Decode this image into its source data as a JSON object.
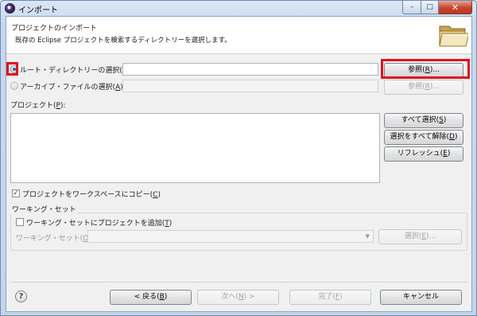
{
  "window": {
    "title": "インポート",
    "icon": "eclipse-icon",
    "controls": {
      "minimize": "–",
      "maximize": "□",
      "close": "✕"
    }
  },
  "header": {
    "title": "プロジェクトのインポート",
    "description": "既存の Eclipse プロジェクトを検索するディレクトリーを選択します。",
    "icon": "folder-icon"
  },
  "source": {
    "root_dir_label": "ルート・ディレクトリーの選択(",
    "root_dir_mnemonic": "T",
    "root_dir_selected": true,
    "root_dir_value": "",
    "root_browse_label": "参照(",
    "root_browse_mnemonic": "R",
    "archive_label": "アーカイブ・ファイルの選択(",
    "archive_mnemonic": "A",
    "archive_selected": false,
    "archive_value": "",
    "archive_browse_label": "参照(",
    "archive_browse_mnemonic": "R"
  },
  "projects": {
    "label": "プロジェクト(",
    "mnemonic": "P",
    "items": [],
    "buttons": {
      "select_all": "すべて選択(",
      "select_all_mnemonic": "S",
      "deselect_all": "選択をすべて解除(",
      "deselect_all_mnemonic": "D",
      "refresh": "リフレッシュ(",
      "refresh_mnemonic": "E"
    }
  },
  "copy_option": {
    "label": "プロジェクトをワークスペースにコピー(",
    "mnemonic": "C",
    "checked": true
  },
  "working_set": {
    "group_title": "ワーキング・セット",
    "add_label": "ワーキング・セットにプロジェクトを追加(",
    "add_mnemonic": "T",
    "add_checked": false,
    "field_label": "ワーキング・セット(",
    "field_mnemonic": "O",
    "field_value": "",
    "select_button": "選択(",
    "select_mnemonic": "E",
    "select_suffix": ")..."
  },
  "footer": {
    "back": "< 戻る(",
    "back_mnemonic": "B",
    "next": "次へ(",
    "next_mnemonic": "N",
    "next_suffix": ") >",
    "finish": "完了(",
    "finish_mnemonic": "F",
    "cancel": "キャンセル"
  },
  "colors": {
    "highlight": "#e0101e",
    "title_bar": "#c7d8ee",
    "dialog_bg": "#f0f0f0"
  }
}
